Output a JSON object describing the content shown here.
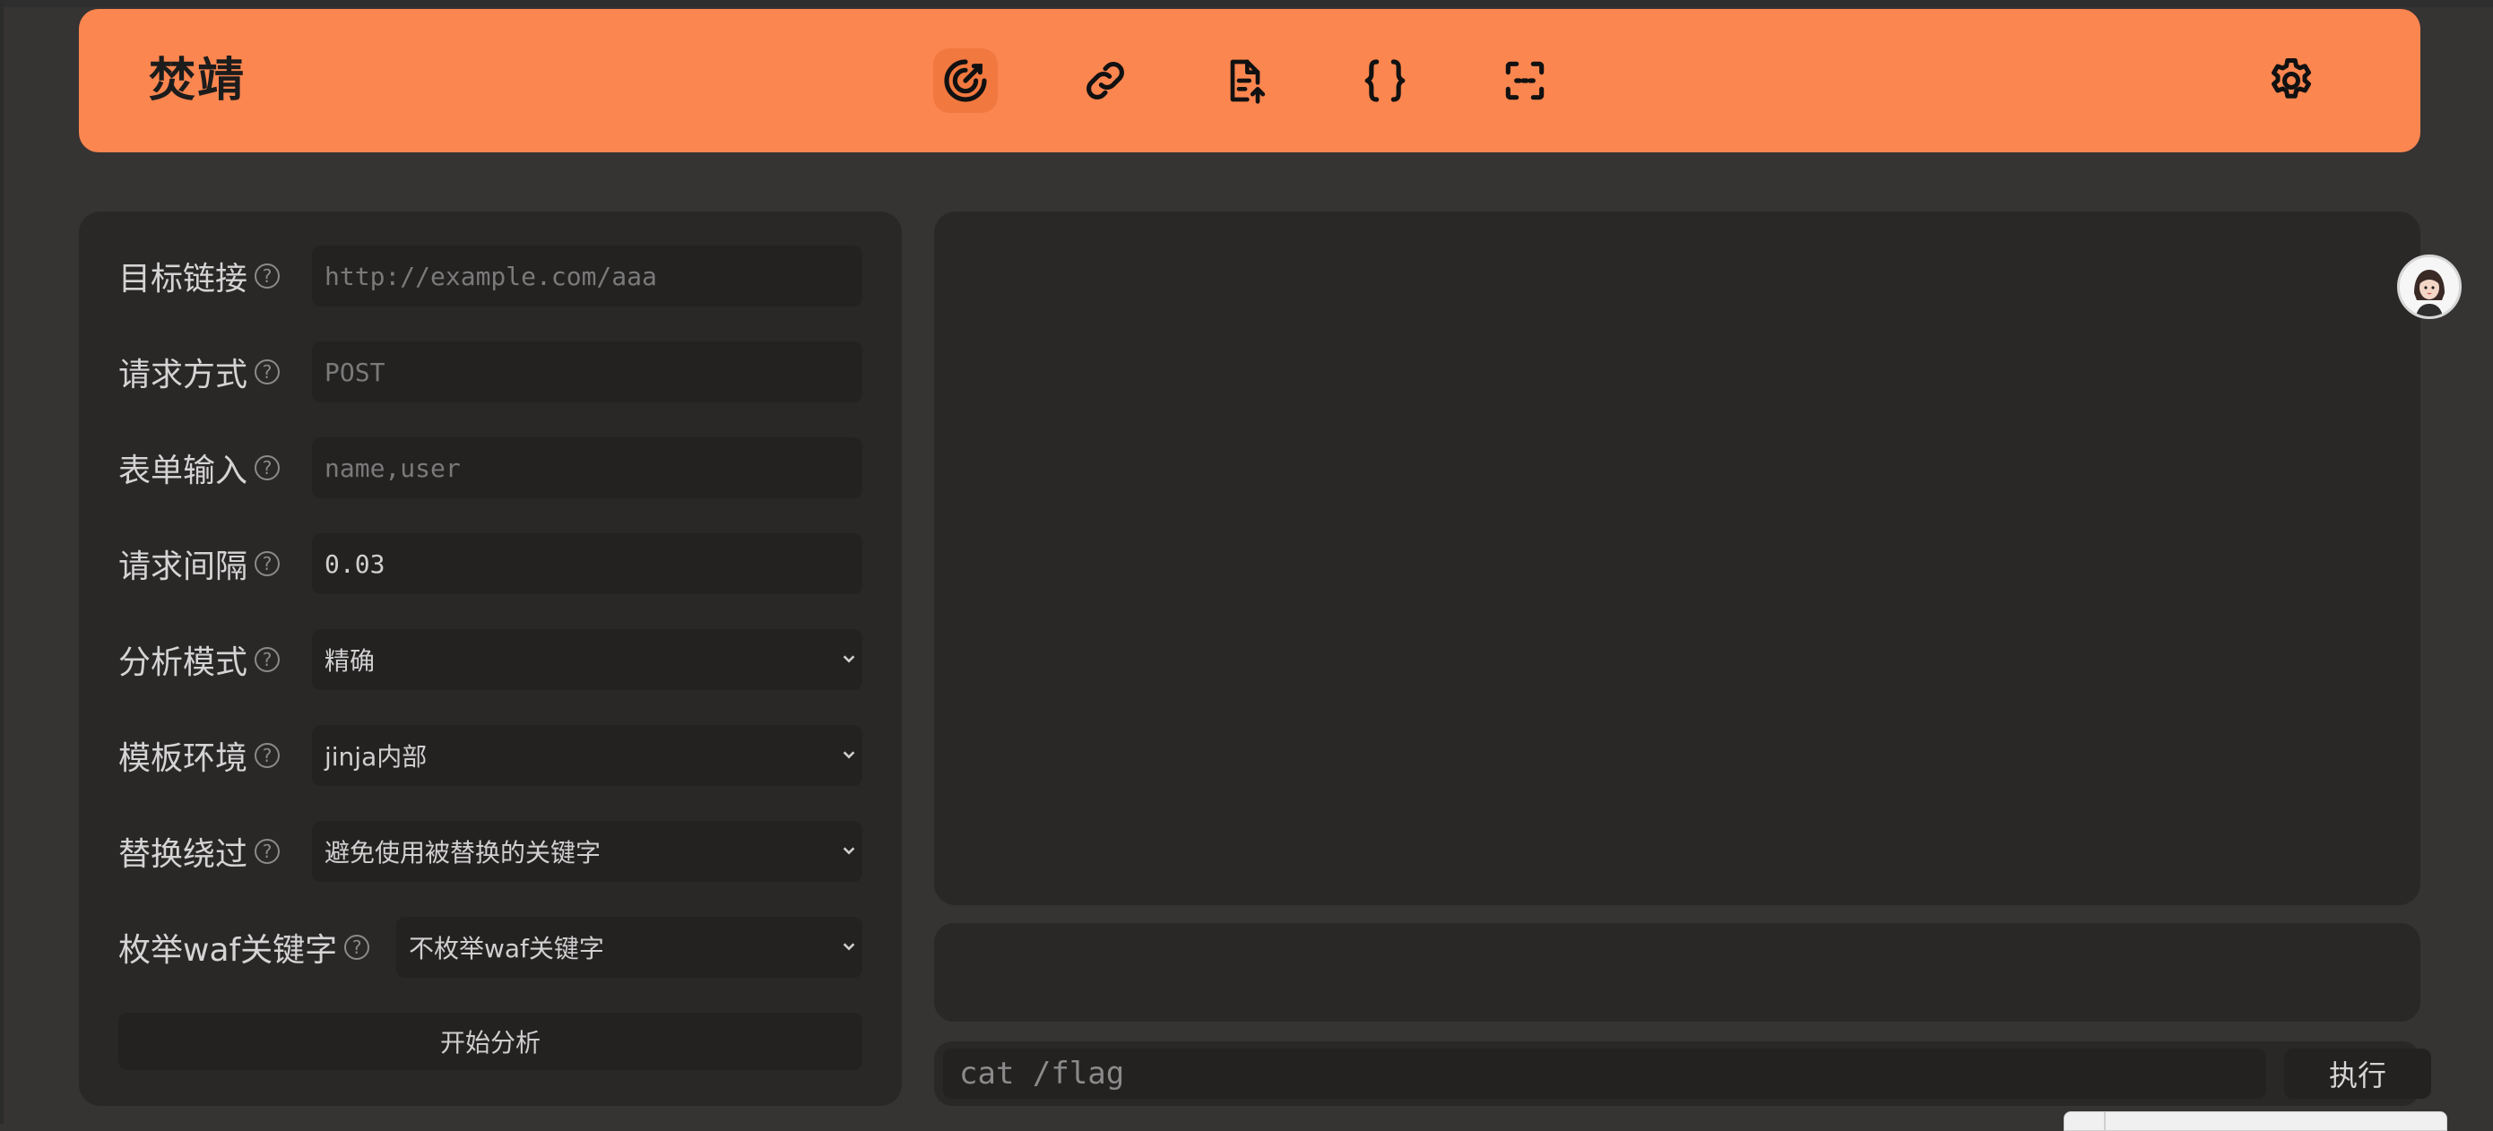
{
  "app": {
    "title": "焚靖"
  },
  "nav": {
    "items": [
      {
        "icon": "target-icon",
        "active": true
      },
      {
        "icon": "link-icon",
        "active": false
      },
      {
        "icon": "file-upload-icon",
        "active": false
      },
      {
        "icon": "braces-icon",
        "active": false
      },
      {
        "icon": "scan-frame-icon",
        "active": false
      }
    ],
    "settings_icon": "gear-icon"
  },
  "form": {
    "target_url": {
      "label": "目标链接",
      "placeholder": "http://example.com/aaa",
      "value": ""
    },
    "method": {
      "label": "请求方式",
      "placeholder": "POST",
      "value": ""
    },
    "inputs": {
      "label": "表单输入",
      "placeholder": "name,user",
      "value": ""
    },
    "interval": {
      "label": "请求间隔",
      "placeholder": "",
      "value": "0.03"
    },
    "analysis_mode": {
      "label": "分析模式",
      "selected": "精确"
    },
    "template_env": {
      "label": "模板环境",
      "selected": "jinja内部"
    },
    "replace_bypass": {
      "label": "替换绕过",
      "selected": "避免使用被替换的关键字"
    },
    "waf_enum": {
      "label": "枚举waf关键字",
      "selected": "不枚举waf关键字"
    },
    "help_glyph": "?",
    "start_button": "开始分析"
  },
  "console": {
    "output": "",
    "result": "",
    "command_placeholder": "cat /flag",
    "command_value": "",
    "execute_button": "执行"
  },
  "colors": {
    "accent": "#fb864f",
    "background": "#363333",
    "panel": "#2a2727",
    "field": "#242121"
  }
}
